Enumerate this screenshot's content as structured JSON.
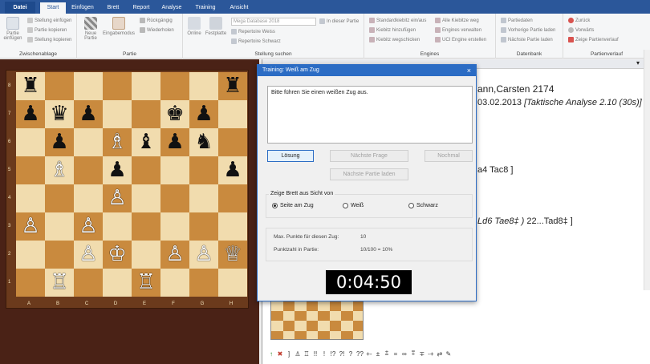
{
  "ribbon_tabs": [
    "Datei",
    "Start",
    "Einfügen",
    "Brett",
    "Report",
    "Analyse",
    "Training",
    "Ansicht"
  ],
  "active_tab": "Start",
  "zwischenablage": {
    "label": "Zwischenablage",
    "big_button": "Partie einfügen",
    "items": [
      "Stellung einfügen",
      "Partie kopieren",
      "Stellung kopieren"
    ]
  },
  "partie": {
    "label": "Partie",
    "neue_partie": "Neue Partie",
    "eingabemodus": "Eingabemodus",
    "items": [
      "Rückgängig",
      "Wiederholen"
    ]
  },
  "stellung_suchen": {
    "label": "Stellung suchen",
    "online": "Online",
    "festplatte": "Festplatte",
    "database": "Mega Database 2018",
    "items": [
      "Repertoire Weiss",
      "Repertoire Schwarz"
    ],
    "in_dieser_partie": "In dieser Partie"
  },
  "engines": {
    "label": "Engines",
    "items": [
      "Standardkiebitz ein/aus",
      "Kiebitz hinzufügen",
      "Kiebitz wegschicken",
      "Alle Kiebitze weg",
      "Engines verwalten",
      "UCI Engine erstellen"
    ]
  },
  "datenbank": {
    "label": "Datenbank",
    "items": [
      "Partiedaten",
      "Vorherige Partie laden",
      "Nächste Partie laden"
    ]
  },
  "partienverlauf": {
    "label": "Partienverlauf",
    "items": [
      "Zurück",
      "Vorwärts",
      "Zeige Partienverlauf"
    ]
  },
  "board": {
    "ranks": [
      "8",
      "7",
      "6",
      "5",
      "4",
      "3",
      "2",
      "1"
    ],
    "files": [
      "A",
      "B",
      "C",
      "D",
      "E",
      "F",
      "G",
      "H"
    ],
    "pieces": [
      {
        "sq": "a8",
        "glyph": "♜",
        "color": "black"
      },
      {
        "sq": "h8",
        "glyph": "♜",
        "color": "black"
      },
      {
        "sq": "a7",
        "glyph": "♟",
        "color": "black"
      },
      {
        "sq": "b7",
        "glyph": "♛",
        "color": "black"
      },
      {
        "sq": "c7",
        "glyph": "♟",
        "color": "black"
      },
      {
        "sq": "f7",
        "glyph": "♚",
        "color": "black"
      },
      {
        "sq": "g7",
        "glyph": "♟",
        "color": "black"
      },
      {
        "sq": "b6",
        "glyph": "♟",
        "color": "black"
      },
      {
        "sq": "d6",
        "glyph": "♗",
        "color": "white"
      },
      {
        "sq": "e6",
        "glyph": "♝",
        "color": "black"
      },
      {
        "sq": "f6",
        "glyph": "♟",
        "color": "black"
      },
      {
        "sq": "g6",
        "glyph": "♞",
        "color": "black"
      },
      {
        "sq": "b5",
        "glyph": "♗",
        "color": "white"
      },
      {
        "sq": "d5",
        "glyph": "♟",
        "color": "black"
      },
      {
        "sq": "h5",
        "glyph": "♟",
        "color": "black"
      },
      {
        "sq": "d4",
        "glyph": "♙",
        "color": "white"
      },
      {
        "sq": "a3",
        "glyph": "♙",
        "color": "white"
      },
      {
        "sq": "c3",
        "glyph": "♙",
        "color": "white"
      },
      {
        "sq": "c2",
        "glyph": "♙",
        "color": "white"
      },
      {
        "sq": "d2",
        "glyph": "♔",
        "color": "white"
      },
      {
        "sq": "f2",
        "glyph": "♙",
        "color": "white"
      },
      {
        "sq": "g2",
        "glyph": "♙",
        "color": "white"
      },
      {
        "sq": "h2",
        "glyph": "♕",
        "color": "white"
      },
      {
        "sq": "b1",
        "glyph": "♖",
        "color": "white"
      },
      {
        "sq": "e1",
        "glyph": "♖",
        "color": "white"
      }
    ]
  },
  "notation": {
    "line1": "ann,Carsten 2174",
    "line2_date": "03.02.2013",
    "line2_italic": "[Taktische Analyse 2.10 (30s)]",
    "line3": "a4  Tac8 ]",
    "line4_italic": "Ld6  Tae8‡ )",
    "line4_rest": "22...Tad8‡ ]"
  },
  "dialog": {
    "title": "Training: Weiß am Zug",
    "close": "×",
    "message": "Bitte führen Sie einen weißen Zug aus.",
    "buttons": {
      "loesung": "Lösung",
      "naechste_frage": "Nächste Frage",
      "nochmal": "Nochmal",
      "naechste_partie": "Nächste Partie laden"
    },
    "view_group": "Zeige Brett aus Sicht von",
    "radios": [
      "Seite am Zug",
      "Weiß",
      "Schwarz"
    ],
    "selected_radio": "Seite am Zug",
    "max_punkte_label": "Max. Punkte für diesen Zug:",
    "max_punkte_value": "10",
    "punktzahl_label": "Punktzahl in Partie:",
    "punktzahl_value": "10/100 = 10%",
    "timer": "0:04:50"
  },
  "bottom_symbols": [
    "↑",
    "✖",
    "]",
    "♙",
    "♖",
    "!!",
    "!",
    "!?",
    "?!",
    "?",
    "??",
    "+-",
    "±",
    "⩲",
    "=",
    "∞",
    "⩱",
    "∓",
    "-+",
    "⇄",
    "✎"
  ],
  "colors": {
    "ribbon_blue": "#2b579a",
    "light_square": "#f1dcae",
    "dark_square": "#c98a3e",
    "dialog_border": "#2b6cc4"
  }
}
